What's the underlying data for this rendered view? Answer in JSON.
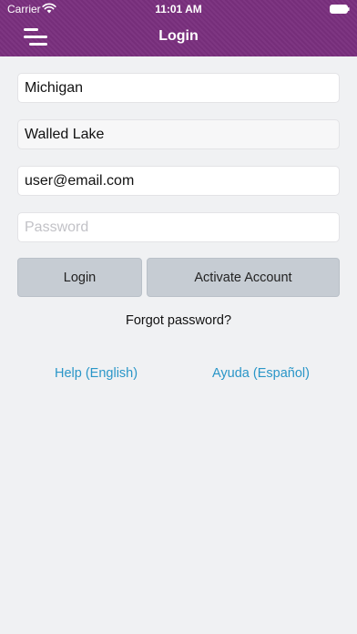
{
  "status_bar": {
    "carrier": "Carrier",
    "time": "11:01 AM"
  },
  "nav": {
    "title": "Login",
    "menu_icon": "menu-icon"
  },
  "form": {
    "state_value": "Michigan",
    "city_value": "Walled Lake",
    "email_value": "user@email.com",
    "password_placeholder": "Password"
  },
  "buttons": {
    "login_label": "Login",
    "activate_label": "Activate Account"
  },
  "links": {
    "forgot_password": "Forgot password?",
    "help_english": "Help (English)",
    "help_spanish": "Ayuda (Español)"
  },
  "colors": {
    "header": "#7a2f7e",
    "link": "#2a96c8",
    "button": "#c6ccd3",
    "background": "#f0f1f3"
  }
}
